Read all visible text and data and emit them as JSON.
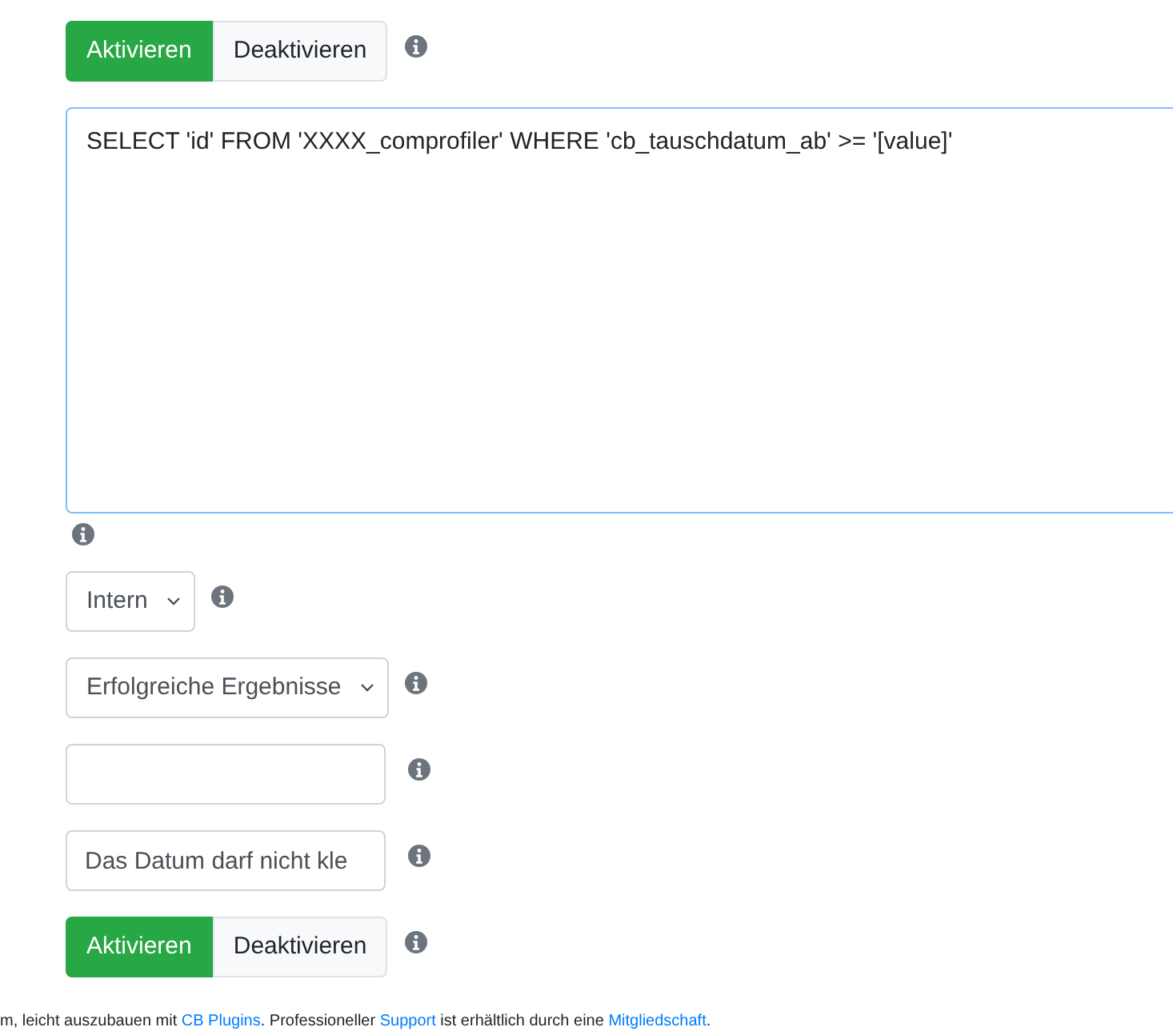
{
  "fields": [
    {
      "kind": "toggle",
      "options": [
        {
          "label": "Aktivieren",
          "selected": true
        },
        {
          "label": "Deaktivieren",
          "selected": false
        }
      ]
    },
    {
      "kind": "textarea",
      "value": "SELECT 'id' FROM 'XXXX_comprofiler' WHERE 'cb_tauschdatum_ab' >= '[value]'"
    },
    {
      "kind": "select",
      "value": "Intern"
    },
    {
      "kind": "select",
      "value": "Erfolgreiche Ergebnisse"
    },
    {
      "kind": "input"
    },
    {
      "kind": "input",
      "value": "Das Datum darf nicht kle"
    },
    {
      "kind": "toggle",
      "options": [
        {
          "label": "Aktivieren",
          "selected": true
        },
        {
          "label": "Deaktivieren",
          "selected": false
        }
      ]
    }
  ],
  "footer": [
    {
      "text": "m, leicht auszubauen mit ",
      "link": false
    },
    {
      "text": "CB Plugins",
      "link": true
    },
    {
      "text": ". Professioneller ",
      "link": false
    },
    {
      "text": "Support",
      "link": true
    },
    {
      "text": " ist erhältlich durch eine ",
      "link": false
    },
    {
      "text": "Mitgliedschaft",
      "link": true
    },
    {
      "text": ".",
      "link": false
    }
  ]
}
